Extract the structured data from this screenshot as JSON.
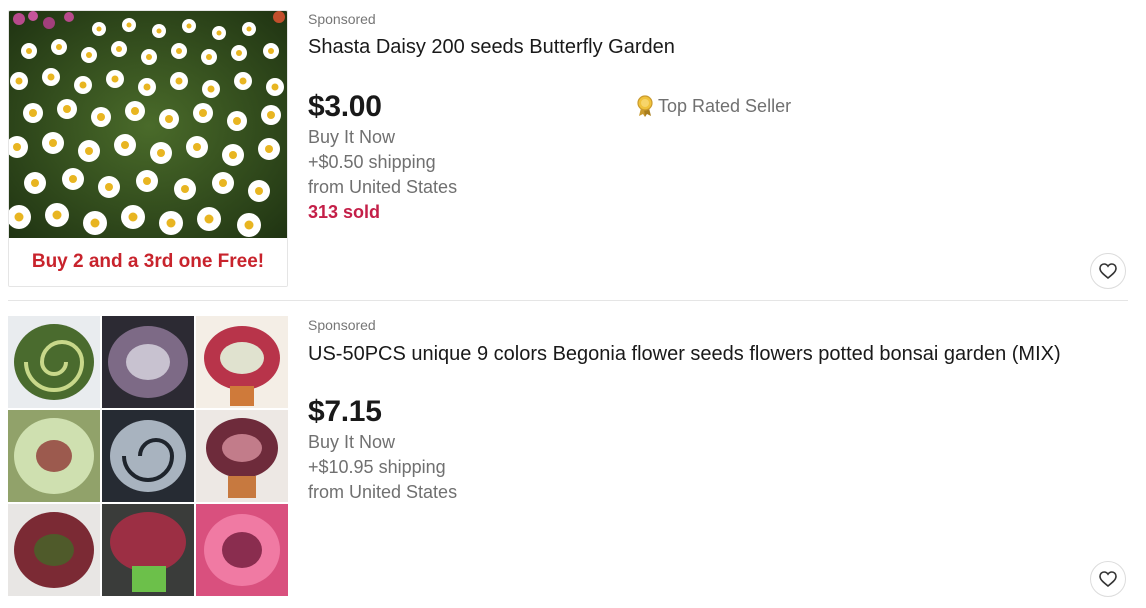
{
  "listings": [
    {
      "sponsored": "Sponsored",
      "title": "Shasta Daisy 200 seeds Butterfly Garden",
      "price": "$3.00",
      "buy_format": "Buy It Now",
      "shipping": "+$0.50 shipping",
      "location": "from United States",
      "sold": "313 sold",
      "badge": "Top Rated Seller",
      "image_banner": "Buy 2 and a 3rd one Free!",
      "image_icon": "daisy-photo"
    },
    {
      "sponsored": "Sponsored",
      "title": "US-50PCS unique 9 colors Begonia flower seeds flowers potted bonsai garden (MIX)",
      "price": "$7.15",
      "buy_format": "Buy It Now",
      "shipping": "+$10.95 shipping",
      "location": "from United States",
      "image_icon": "begonia-collage-photo"
    }
  ],
  "colors": {
    "sold_accent": "#c41f48",
    "banner_text": "#c8232c",
    "muted_text": "#707070"
  }
}
